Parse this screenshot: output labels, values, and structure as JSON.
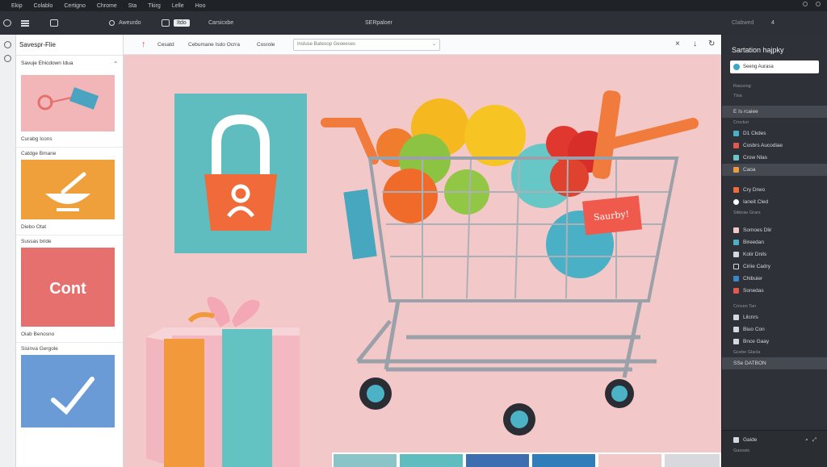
{
  "menubar": {
    "items": [
      "Ekip",
      "Colablo",
      "Certigno",
      "Chrome",
      "Sta",
      "Tkirg",
      "Lelle",
      "Hoo"
    ]
  },
  "toolbar": {
    "mode": "Aweurdo",
    "tab": "Itdo",
    "center_label": "Carsicxbe",
    "middle_label": "SERpaloer",
    "right_label": "Clabwed",
    "right_value": "4"
  },
  "leftpanel": {
    "title": "Savespr-Flie",
    "subtitle": "Savuje Ehicdown Idua",
    "captions": [
      "Curabg Icons",
      "Catdge Bmane",
      "Diebo Otat",
      "Sussas bride",
      "Oiab Benosno",
      "Sisinva Gergole"
    ]
  },
  "secbar": {
    "items": [
      "Cesatd",
      "Cebumane Isdo Ocrra",
      "Cosrole"
    ],
    "search_value": "Insluse Bateoop Geoeeses"
  },
  "canvas": {
    "cart_tag": "Saurby!"
  },
  "rightpanel": {
    "title": "Sartation hajpky",
    "search_value": "Seeng Aurasa",
    "items_top": [
      "Rasuvng",
      "Ttsa"
    ],
    "highlight_1": "E Is rcaiee",
    "section_1": "Croctun",
    "items_mid": [
      "D1 Ckdes",
      "Cosbrs Aucodiae",
      "Crow Nlas",
      "Caoa"
    ],
    "items_low": [
      "Cry Drwo",
      "Ianeit Cled",
      "Sitkirae Grars"
    ],
    "items_tools": [
      "Somoes Dlir",
      "Bireedan",
      "Kolir Dnils",
      "Ciriie Cadry",
      "Chibuier",
      "Sonedas"
    ],
    "section_2": "Crnceo Tan",
    "items_end": [
      "Lilcnrs",
      "Biuo Con",
      "Bnce Gaay",
      "Gcebe Glacla"
    ],
    "highlight_2": "SSe DATBON",
    "bottom_label": "Gaide",
    "bottom_sub": "Gasoatc"
  }
}
